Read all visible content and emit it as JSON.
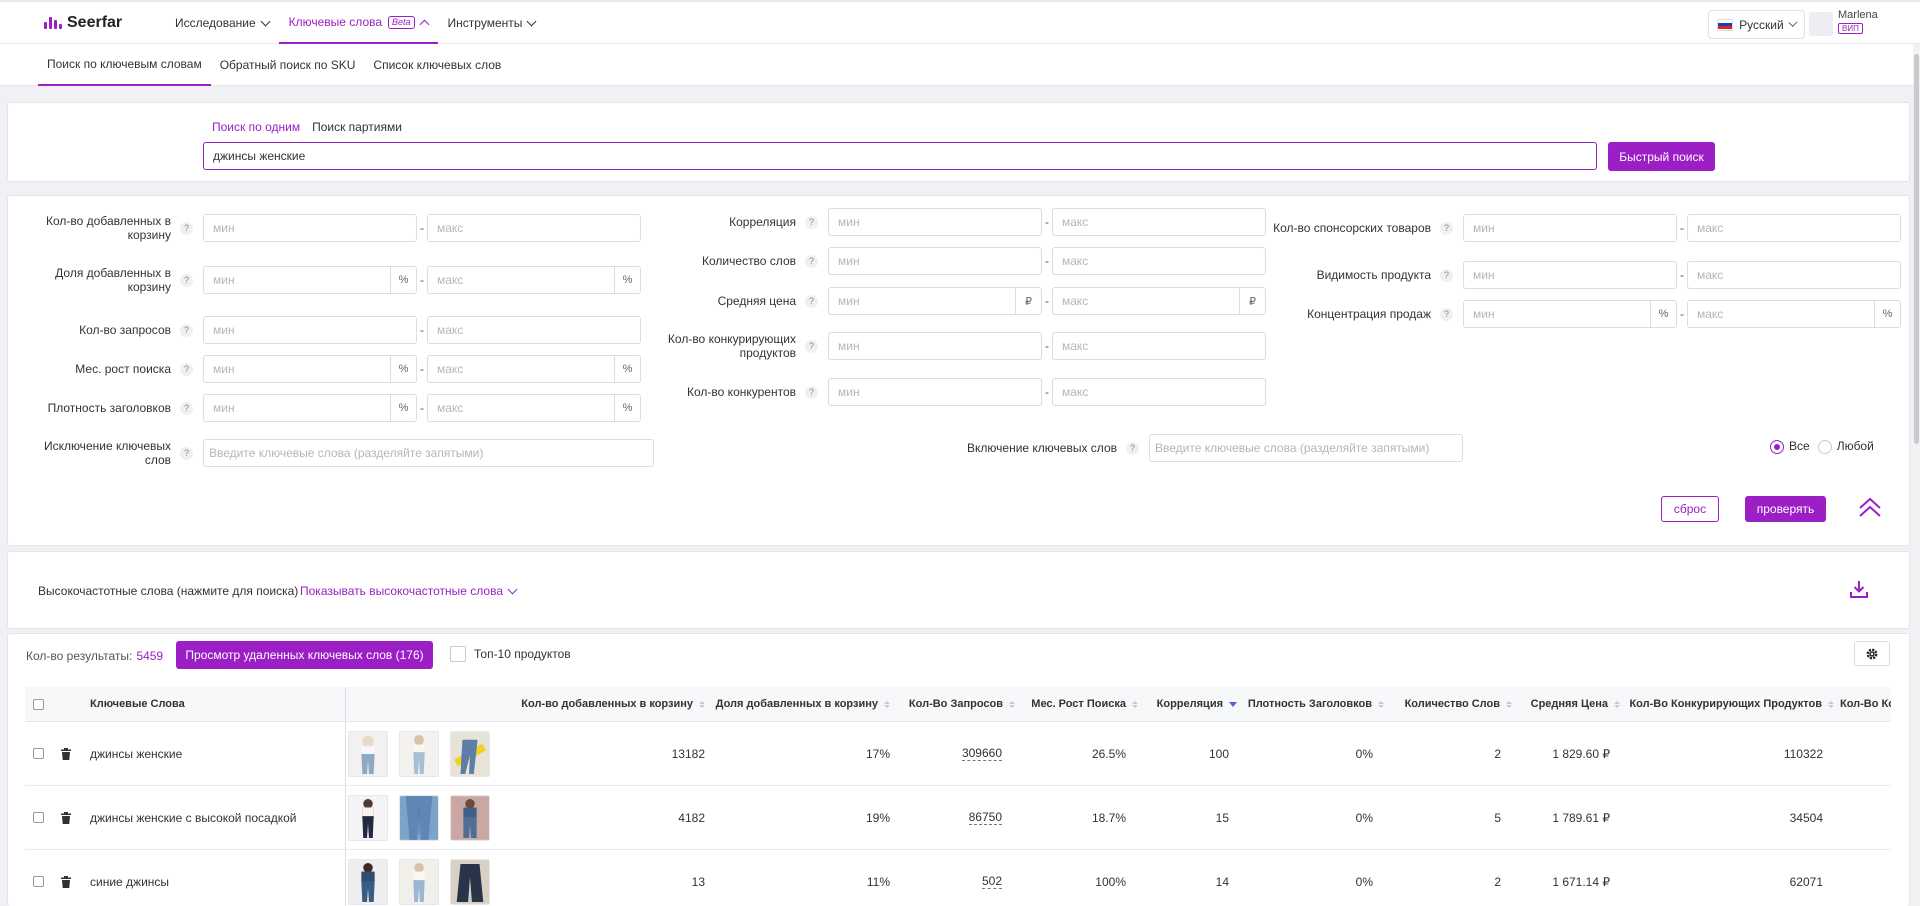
{
  "app": {
    "logo_text": "Seerfar"
  },
  "nav": {
    "items": [
      {
        "label": "Исследование",
        "active": false
      },
      {
        "label": "Ключевые слова",
        "badge": "Beta",
        "active": true
      },
      {
        "label": "Инструменты",
        "active": false
      }
    ]
  },
  "lang": {
    "label": "Русский"
  },
  "user": {
    "name": "Marlena",
    "badge": "ВИП"
  },
  "subnav": {
    "items": [
      {
        "label": "Поиск по ключевым словам",
        "active": true
      },
      {
        "label": "Обратный поиск по SKU",
        "active": false
      },
      {
        "label": "Список ключевых слов",
        "active": false
      }
    ]
  },
  "search": {
    "tab_single": "Поиск по одним",
    "tab_batch": "Поиск партиями",
    "value": "джинсы женские",
    "button": "Быстрый поиск"
  },
  "filters": {
    "min": "мин",
    "max": "макс",
    "percent": "%",
    "ruble": "₽",
    "help": "?",
    "col1": [
      "Кол-во добавленных в корзину",
      "Доля добавленных в корзину",
      "Кол-во запросов",
      "Мес. рост поиска",
      "Плотность заголовков"
    ],
    "col2": [
      "Корреляция",
      "Количество слов",
      "Средняя цена",
      "Кол-во конкурирующих продуктов",
      "Кол-во конкурентов"
    ],
    "col3": [
      "Кол-во спонсорских товаров",
      "Видимость продукта",
      "Концентрация продаж"
    ],
    "exclude_label": "Исключение ключевых слов",
    "exclude_placeholder": "Введите ключевые слова (разделяйте запятыми)",
    "include_label": "Включение ключевых слов",
    "include_placeholder": "Введите ключевые слова (разделяйте запятыми)",
    "radio_all": "Все",
    "radio_any": "Любой",
    "reset": "сброс",
    "check": "проверять"
  },
  "high_freq": {
    "label": "Высокочастотные слова (нажмите для поиска)",
    "link": "Показывать высокочастотные слова"
  },
  "results": {
    "count_label": "Кол-во результаты:",
    "count_value": "5459",
    "deleted_button": "Просмотр удаленных ключевых слов (176)",
    "top10": "Топ-10 продуктов"
  },
  "table": {
    "headers": {
      "keyword": "Ключевые Слова",
      "cart": "Кол-во добавленных в корзину",
      "cart_share": "Доля добавленных в корзину",
      "queries": "Кол-Во Запросов",
      "growth": "Мес. Рост Поиска",
      "correlation": "Корреляция",
      "title_density": "Плотность Заголовков",
      "words": "Количество Слов",
      "avg_price": "Средняя Цена",
      "competing": "Кол-Во Конкурирующих Продуктов",
      "competitors": "Кол-Во Кон"
    },
    "rows": [
      {
        "keyword": "джинсы женские",
        "cart": "13182",
        "cart_share": "17%",
        "queries": "309660",
        "growth": "26.5%",
        "correlation": "100",
        "title_density": "0%",
        "words": "2",
        "avg_price": "1 829.60 ₽",
        "competing": "110322"
      },
      {
        "keyword": "джинсы женские с высокой посадкой",
        "cart": "4182",
        "cart_share": "19%",
        "queries": "86750",
        "growth": "18.7%",
        "correlation": "15",
        "title_density": "0%",
        "words": "5",
        "avg_price": "1 789.61 ₽",
        "competing": "34504"
      },
      {
        "keyword": "синие джинсы",
        "cart": "13",
        "cart_share": "11%",
        "queries": "502",
        "growth": "100%",
        "correlation": "14",
        "title_density": "0%",
        "words": "2",
        "avg_price": "1 671.14 ₽",
        "competing": "62071"
      }
    ]
  },
  "colors": {
    "accent": "#9b1fc4",
    "sort_active": "#4a64d8"
  }
}
